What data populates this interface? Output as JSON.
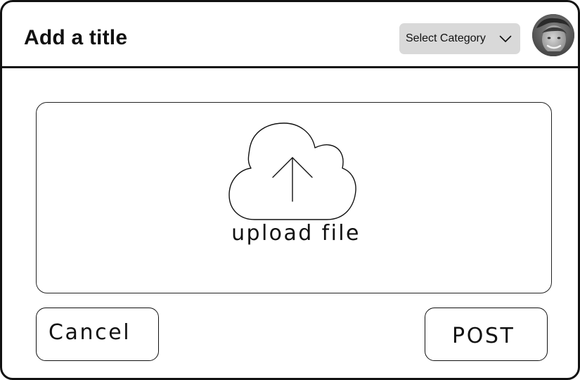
{
  "header": {
    "title": "Add a title",
    "category_select": {
      "selected": "Select Category",
      "icon": "chevron-down-icon"
    },
    "avatar": {
      "icon": "user-avatar"
    }
  },
  "upload": {
    "label": "upload file",
    "icon": "cloud-upload-icon"
  },
  "actions": {
    "cancel_label": "Cancel",
    "post_label": "POST"
  },
  "colors": {
    "border": "#111111",
    "select_background": "#d9d9d9",
    "background": "#ffffff"
  }
}
